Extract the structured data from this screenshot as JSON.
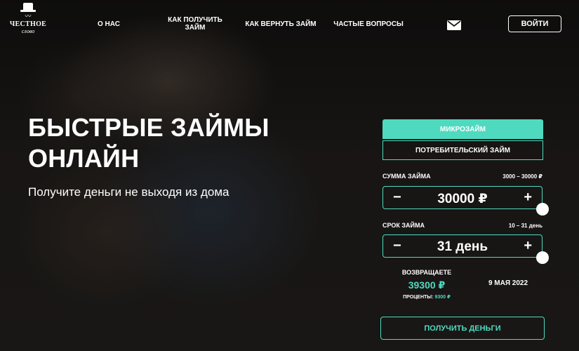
{
  "header": {
    "logo": {
      "line1": "ЧЕСТНОЕ",
      "line2": "слово"
    },
    "nav": [
      {
        "label": "О НАС"
      },
      {
        "label": "КАК ПОЛУЧИТЬ ЗАЙМ"
      },
      {
        "label": "КАК ВЕРНУТЬ ЗАЙМ"
      },
      {
        "label": "ЧАСТЫЕ ВОПРОСЫ"
      }
    ],
    "mail_icon": "envelope-icon",
    "login_label": "ВОЙТИ"
  },
  "hero": {
    "title_line1": "БЫСТРЫЕ ЗАЙМЫ",
    "title_line2": "ОНЛАЙН",
    "subtitle": "Получите деньги не выходя из дома"
  },
  "calculator": {
    "tabs": [
      {
        "label": "МИКРОЗАЙМ",
        "active": true
      },
      {
        "label": "ПОТРЕБИТЕЛЬСКИЙ ЗАЙМ",
        "active": false
      }
    ],
    "amount": {
      "label": "СУММА ЗАЙМА",
      "range": "3000 – 30000 ₽",
      "value": "30000 ₽",
      "minus": "−",
      "plus": "+",
      "slider_fraction": 1.0
    },
    "term": {
      "label": "СРОК ЗАЙМА",
      "range": "10 – 31 день",
      "value": "31 день",
      "minus": "−",
      "plus": "+",
      "slider_fraction": 1.0
    },
    "return": {
      "label": "ВОЗВРАЩАЕТЕ",
      "value": "39300 ₽",
      "percent_label": "ПРОЦЕНТЫ:",
      "percent_value": "9300 ₽"
    },
    "return_date": "9 МАЯ 2022",
    "submit_label": "ПОЛУЧИТЬ ДЕНЬГИ"
  },
  "colors": {
    "accent": "#4fdac0",
    "text": "#ffffff"
  }
}
